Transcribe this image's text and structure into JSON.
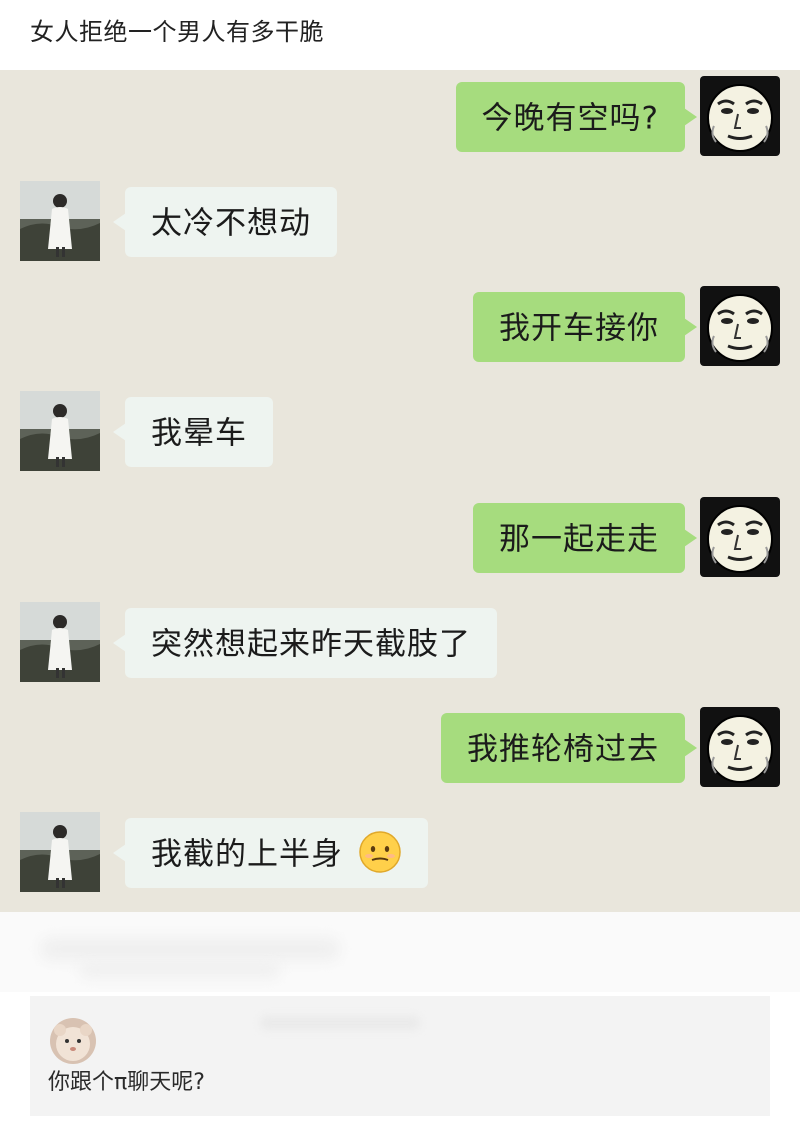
{
  "post": {
    "title": "女人拒绝一个男人有多干脆"
  },
  "chat": {
    "background_color": "#e9e6dc",
    "my_bubble_color": "#a6dc7e",
    "her_bubble_color": "#eef4f0",
    "messages": [
      {
        "sender": "me",
        "text": "今晚有空吗?",
        "avatar_icon": "meme-face-avatar-icon"
      },
      {
        "sender": "her",
        "text": "太冷不想动",
        "avatar_icon": "girl-photo-avatar-icon"
      },
      {
        "sender": "me",
        "text": "我开车接你",
        "avatar_icon": "meme-face-avatar-icon"
      },
      {
        "sender": "her",
        "text": "我晕车",
        "avatar_icon": "girl-photo-avatar-icon"
      },
      {
        "sender": "me",
        "text": "那一起走走",
        "avatar_icon": "meme-face-avatar-icon"
      },
      {
        "sender": "her",
        "text": "突然想起来昨天截肢了",
        "avatar_icon": "girl-photo-avatar-icon"
      },
      {
        "sender": "me",
        "text": "我推轮椅过去",
        "avatar_icon": "meme-face-avatar-icon"
      },
      {
        "sender": "her",
        "text": "我截的上半身",
        "avatar_icon": "girl-photo-avatar-icon",
        "emoji": "awkward-smile-emoji-icon"
      }
    ]
  },
  "comment": {
    "avatar_icon": "user-avatar-icon",
    "text": "你跟个π聊天呢?"
  }
}
